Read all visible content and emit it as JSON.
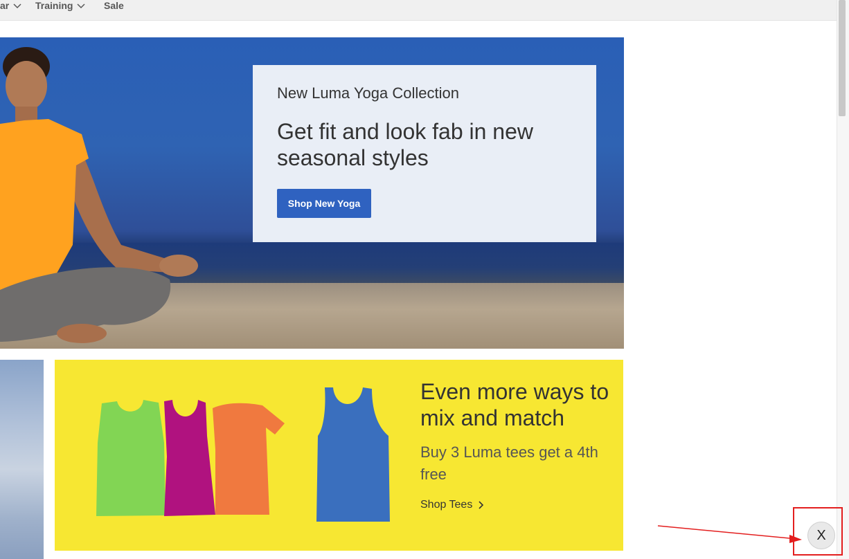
{
  "nav": {
    "items": [
      {
        "label": "ar"
      },
      {
        "label": "Training"
      },
      {
        "label": "Sale"
      }
    ]
  },
  "hero": {
    "eyebrow": "New Luma Yoga Collection",
    "headline": "Get fit and look fab in new seasonal styles",
    "button_label": "Shop New Yoga"
  },
  "tees": {
    "title": "Even more ways to mix and match",
    "subtitle": "Buy 3 Luma tees get a 4th free",
    "link_label": "Shop Tees"
  },
  "close_button": {
    "label": "X"
  },
  "colors": {
    "promo_button": "#2f62c0",
    "tees_background": "#f7e732",
    "annotation": "#e31e1e"
  }
}
